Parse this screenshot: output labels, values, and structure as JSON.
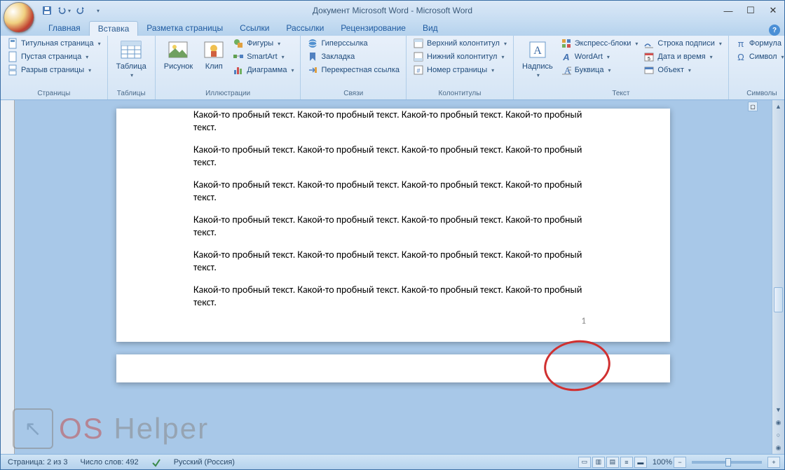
{
  "title": "Документ Microsoft Word - Microsoft Word",
  "tabs": [
    "Главная",
    "Вставка",
    "Разметка страницы",
    "Ссылки",
    "Рассылки",
    "Рецензирование",
    "Вид"
  ],
  "active_tab": 1,
  "ribbon": {
    "pages": {
      "label": "Страницы",
      "items": [
        "Титульная страница",
        "Пустая страница",
        "Разрыв страницы"
      ]
    },
    "tables": {
      "label": "Таблицы",
      "btn": "Таблица"
    },
    "illustrations": {
      "label": "Иллюстрации",
      "big": [
        "Рисунок",
        "Клип"
      ],
      "small": [
        "Фигуры",
        "SmartArt",
        "Диаграмма"
      ]
    },
    "links": {
      "label": "Связи",
      "items": [
        "Гиперссылка",
        "Закладка",
        "Перекрестная ссылка"
      ]
    },
    "headerfooter": {
      "label": "Колонтитулы",
      "items": [
        "Верхний колонтитул",
        "Нижний колонтитул",
        "Номер страницы"
      ]
    },
    "text": {
      "label": "Текст",
      "big": "Надпись",
      "col1": [
        "Экспресс-блоки",
        "WordArt",
        "Буквица"
      ],
      "col2": [
        "Строка подписи",
        "Дата и время",
        "Объект"
      ]
    },
    "symbols": {
      "label": "Символы",
      "items": [
        "Формула",
        "Символ"
      ]
    }
  },
  "document": {
    "paragraph": "Какой-то пробный текст. Какой-то пробный текст. Какой-то пробный текст. Какой-то пробный текст.",
    "para_count": 6,
    "page_number": "1"
  },
  "statusbar": {
    "page": "Страница: 2 из 3",
    "words": "Число слов: 492",
    "lang": "Русский (Россия)",
    "zoom": "100%"
  },
  "watermark": {
    "os": "OS",
    "helper": " Helper"
  }
}
